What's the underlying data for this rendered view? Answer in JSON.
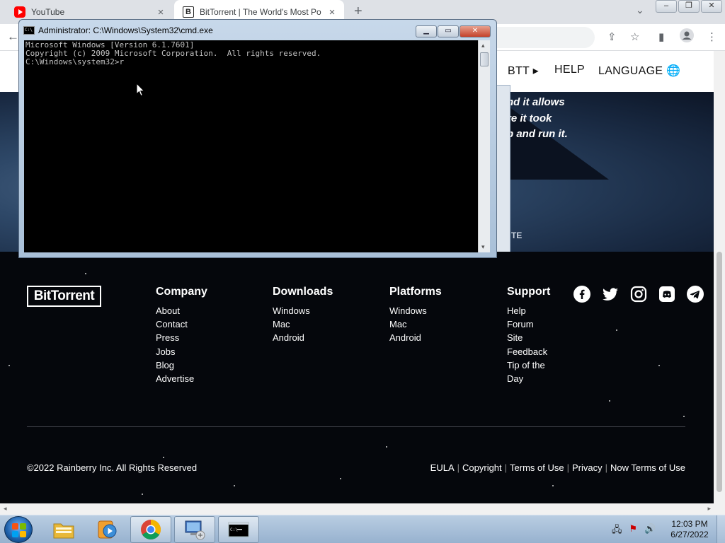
{
  "browser": {
    "tabs": [
      {
        "title": "YouTube",
        "favicon": "youtube-icon"
      },
      {
        "title": "BitTorrent | The World's Most Po",
        "favicon": "bittorrent-icon"
      }
    ],
    "new_tab_label": "+",
    "close_label": "×"
  },
  "site": {
    "nav": {
      "btt": "BTT",
      "help": "HELP",
      "language": "LANGUAGE"
    },
    "hero_lines": [
      "nd it allows",
      "re it took",
      "p and run it."
    ],
    "hero_partial": "TE",
    "logo": "BitTorrent",
    "footer": {
      "columns": [
        {
          "title": "Company",
          "links": [
            "About",
            "Contact",
            "Press",
            "Jobs",
            "Blog",
            "Advertise"
          ]
        },
        {
          "title": "Downloads",
          "links": [
            "Windows",
            "Mac",
            "Android"
          ]
        },
        {
          "title": "Platforms",
          "links": [
            "Windows",
            "Mac",
            "Android"
          ]
        },
        {
          "title": "Support",
          "links": [
            "Help",
            "Forum",
            "Site",
            "Feedback",
            "Tip of the",
            "Day"
          ]
        }
      ],
      "socials": [
        "facebook-icon",
        "twitter-icon",
        "instagram-icon",
        "discord-icon",
        "telegram-icon"
      ],
      "copyright": "©2022 Rainberry Inc. All Rights Reserved",
      "legal": [
        "EULA",
        "Copyright",
        "Terms of Use",
        "Privacy",
        "Now Terms of Use"
      ]
    }
  },
  "cmd": {
    "title": "Administrator: C:\\Windows\\System32\\cmd.exe",
    "lines": [
      "Microsoft Windows [Version 6.1.7601]",
      "Copyright (c) 2009 Microsoft Corporation.  All rights reserved.",
      "",
      "C:\\Windows\\system32>r"
    ]
  },
  "taskbar": {
    "apps": [
      "file-explorer-icon",
      "media-player-icon",
      "chrome-icon",
      "network-icon",
      "cmd-icon"
    ],
    "time": "12:03 PM",
    "date": "6/27/2022"
  },
  "colors": {
    "footer_bg": "#05070c",
    "cmd_bg": "#000000",
    "cmd_text": "#c0c0c0",
    "taskbar": "#a9c0d8"
  }
}
